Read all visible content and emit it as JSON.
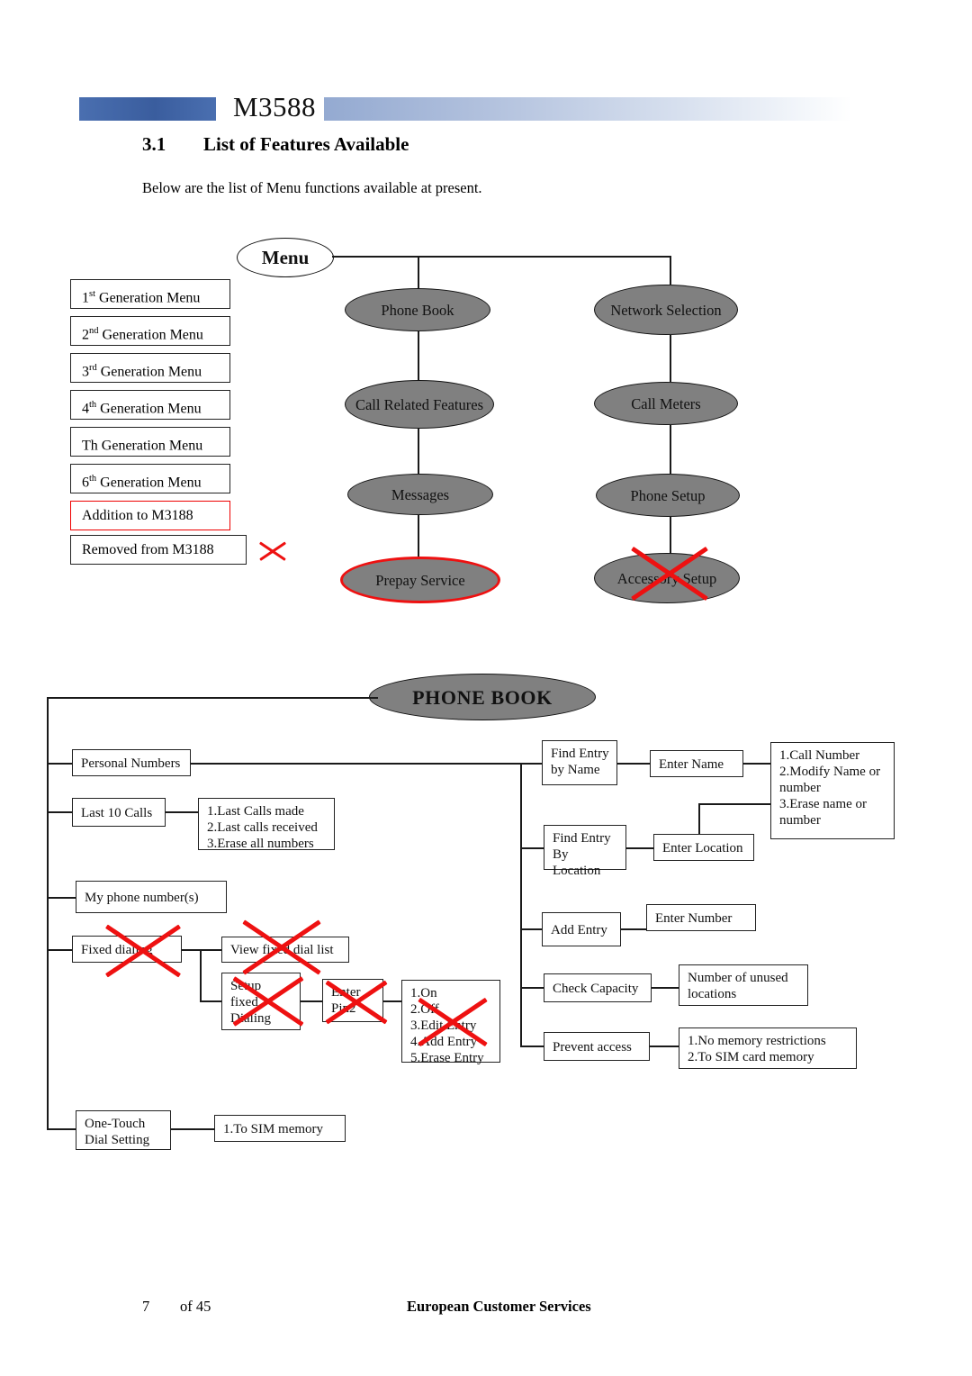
{
  "document": {
    "header_title": "M3588",
    "section_number": "3.1",
    "section_title": "List of Features Available",
    "intro": "Below are the list of Menu functions available at present.",
    "footer_page": "7",
    "footer_page_of": "of 45",
    "footer_org": "European Customer Services"
  },
  "colors": {
    "node_fill": "#808080",
    "accent_red": "#ee1111",
    "band_blue": "#3a5d9e",
    "line": "#1a1a1a"
  },
  "legend": {
    "items": [
      {
        "label": "Generation Menu",
        "ordinal": "1",
        "sup": "st",
        "style": "normal"
      },
      {
        "label": "Generation Menu",
        "ordinal": "2",
        "sup": "nd",
        "style": "normal"
      },
      {
        "label": "Generation Menu",
        "ordinal": "3",
        "sup": "rd",
        "style": "normal"
      },
      {
        "label": "Generation Menu",
        "ordinal": "4",
        "sup": "th",
        "style": "normal"
      },
      {
        "label": "Generation Menu",
        "ordinal": "Th",
        "sup": "",
        "style": "normal"
      },
      {
        "label": "Generation Menu",
        "ordinal": "6",
        "sup": "th",
        "style": "normal"
      },
      {
        "label": "Addition to M3188",
        "ordinal": "",
        "sup": "",
        "style": "red-border"
      },
      {
        "label": "Removed from M3188",
        "ordinal": "",
        "sup": "",
        "style": "crossed"
      }
    ]
  },
  "menu_tree": {
    "root": "Menu",
    "left_column": [
      {
        "label": "Phone Book",
        "marker": "none"
      },
      {
        "label": "Call Related\nFeatures",
        "marker": "none"
      },
      {
        "label": "Messages",
        "marker": "none"
      },
      {
        "label": "Prepay Service",
        "marker": "red-outline"
      }
    ],
    "right_column": [
      {
        "label": "Network\nSelection",
        "marker": "none"
      },
      {
        "label": "Call Meters",
        "marker": "none"
      },
      {
        "label": "Phone Setup",
        "marker": "none"
      },
      {
        "label": "Accessory\nSetup",
        "marker": "crossed"
      }
    ]
  },
  "phone_book": {
    "title": "PHONE BOOK",
    "nodes": {
      "personal_numbers": "Personal Numbers",
      "last_10_calls": "Last 10 Calls",
      "last_10_calls_options": "1.Last Calls made\n2.Last calls received\n3.Erase all numbers",
      "my_phone_numbers": "My phone number(s)",
      "fixed_dialing": "Fixed dialing",
      "view_fixed_dial_list": "View fixed dial list",
      "setup_fixed_dialing": "Setup\nfixed\nDialing",
      "enter_pin2": "Enter\nPin2",
      "pin2_options": "1.On\n2.Off\n3.Edit Entry\n4.Add Entry\n5.Erase Entry",
      "one_touch_dial_setting": "One-Touch\nDial Setting",
      "one_touch_options": "1.To SIM memory",
      "find_entry_by_name": "Find Entry\nby Name",
      "enter_name": "Enter Name",
      "entry_actions": "1.Call Number\n2.Modify Name or\nnumber\n3.Erase name or\nnumber",
      "find_entry_by_location": "Find Entry\nBy Location",
      "enter_location": "Enter Location",
      "add_entry": "Add Entry",
      "enter_number": "Enter Number",
      "check_capacity": "Check Capacity",
      "capacity_result": "Number of unused\nlocations",
      "prevent_access": "Prevent access",
      "prevent_access_options": "1.No memory restrictions\n2.To SIM card memory"
    }
  }
}
